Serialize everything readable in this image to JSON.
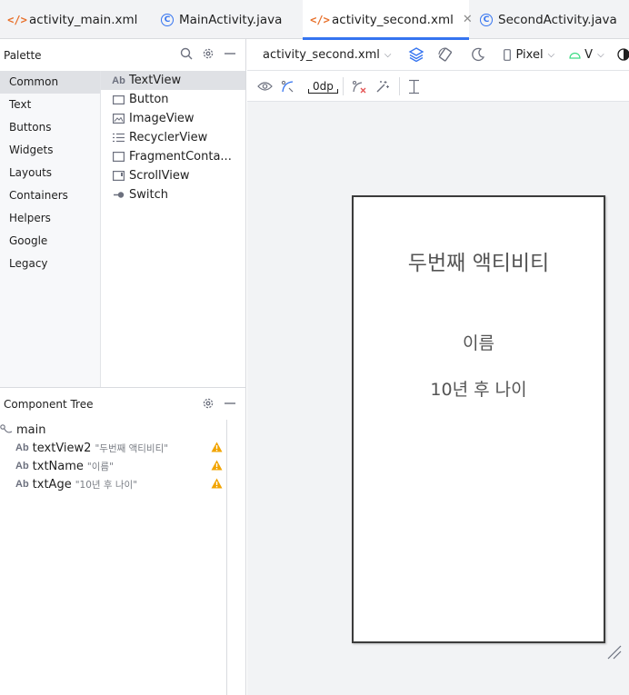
{
  "tabs": [
    {
      "label": "activity_main.xml",
      "icon": "xml-icon",
      "active": false
    },
    {
      "label": "MainActivity.java",
      "icon": "class-icon",
      "active": false
    },
    {
      "label": "activity_second.xml",
      "icon": "xml-icon",
      "active": true
    },
    {
      "label": "SecondActivity.java",
      "icon": "class-icon",
      "active": false
    }
  ],
  "palette": {
    "title": "Palette",
    "categories": [
      "Common",
      "Text",
      "Buttons",
      "Widgets",
      "Layouts",
      "Containers",
      "Helpers",
      "Google",
      "Legacy"
    ],
    "selected_category": "Common",
    "widgets": [
      {
        "label": "TextView",
        "icon": "textview-icon"
      },
      {
        "label": "Button",
        "icon": "button-icon"
      },
      {
        "label": "ImageView",
        "icon": "imageview-icon"
      },
      {
        "label": "RecyclerView",
        "icon": "recyclerview-icon"
      },
      {
        "label": "FragmentConta...",
        "icon": "fragment-icon"
      },
      {
        "label": "ScrollView",
        "icon": "scrollview-icon"
      },
      {
        "label": "Switch",
        "icon": "switch-icon"
      }
    ]
  },
  "component_tree": {
    "title": "Component Tree",
    "root": "main",
    "items": [
      {
        "id": "textView2",
        "text": "\"두번째 액티비티\"",
        "icon": "textview-icon",
        "warning": true
      },
      {
        "id": "txtName",
        "text": "\"이름\"",
        "icon": "textview-icon",
        "warning": true
      },
      {
        "id": "txtAge",
        "text": "\"10년 후 나이\"",
        "icon": "textview-icon",
        "warning": true
      }
    ]
  },
  "toolbar": {
    "file_select": "activity_second.xml",
    "device_select": "Pixel",
    "api_select": "V",
    "margin_value": "0dp"
  },
  "device": {
    "title": "두번째 액티비티",
    "name": "이름",
    "age": "10년 후 나이"
  },
  "colors": {
    "accent": "#3574f0",
    "xml_icon": "#e8702a",
    "warning": "#f2a400"
  }
}
